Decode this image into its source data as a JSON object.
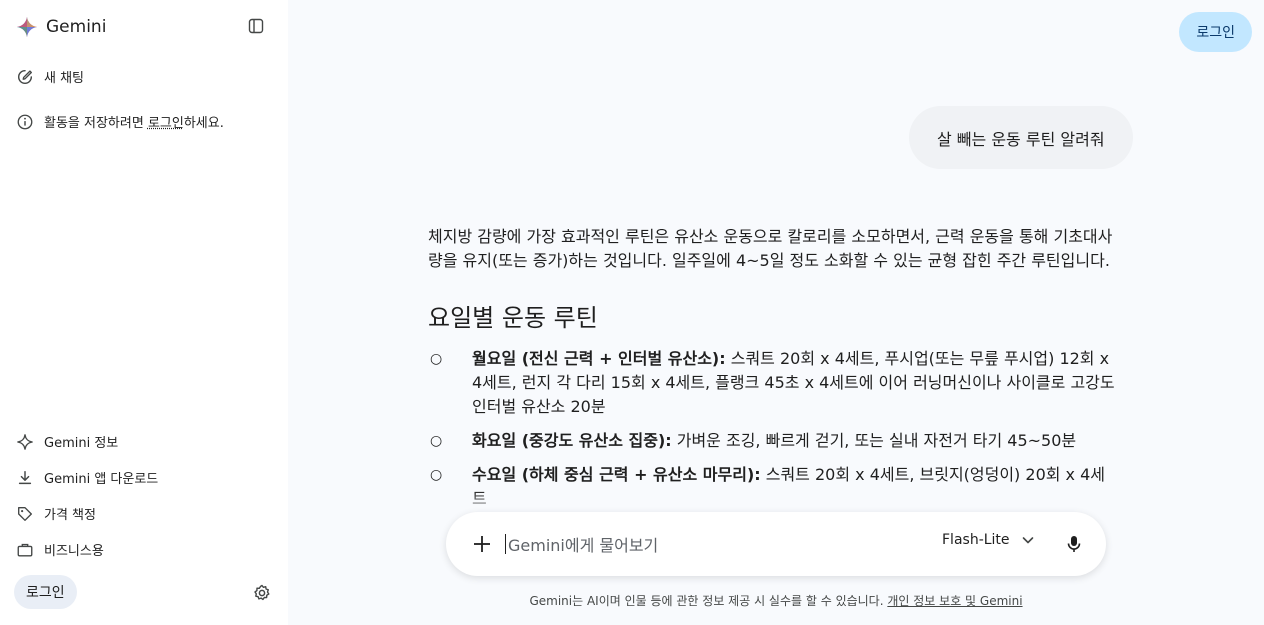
{
  "sidebar": {
    "brand": "Gemini",
    "new_chat": "새 채팅",
    "hint_prefix": "활동을 저장하려면 ",
    "hint_link": "로그인",
    "hint_suffix": "하세요.",
    "bottom_items": [
      {
        "label": "Gemini 정보",
        "icon": "sparkle-icon"
      },
      {
        "label": "Gemini 앱 다운로드",
        "icon": "download-icon"
      },
      {
        "label": "가격 책정",
        "icon": "tag-icon"
      },
      {
        "label": "비즈니스용",
        "icon": "briefcase-icon"
      }
    ],
    "login": "로그인"
  },
  "header": {
    "login": "로그인"
  },
  "chat": {
    "user_message": "살 빼는 운동 루틴 알려줘",
    "response_intro": "체지방 감량에 가장 효과적인 루틴은 유산소 운동으로 칼로리를 소모하면서, 근력 운동을 통해 기초대사량을 유지(또는 증가)하는 것입니다. 일주일에 4~5일 정도 소화할 수 있는 균형 잡힌 주간 루틴입니다.",
    "section_title": "요일별 운동 루틴",
    "items": [
      {
        "bold": "월요일 (전신 근력 + 인터벌 유산소):",
        "text": " 스쿼트 20회 x 4세트, 푸시업(또는 무릎 푸시업) 12회 x 4세트, 런지 각 다리 15회 x 4세트, 플랭크 45초 x 4세트에 이어 러닝머신이나 사이클로 고강도 인터벌 유산소 20분"
      },
      {
        "bold": "화요일 (중강도 유산소 집중):",
        "text": " 가벼운 조깅, 빠르게 걷기, 또는 실내 자전거 타기 45~50분"
      },
      {
        "bold": "수요일 (하체 중심 근력 + 유산소 마무리):",
        "text": " 스쿼트 20회 x 4세트, 브릿지(엉덩이) 20회 x 4세트"
      }
    ]
  },
  "composer": {
    "placeholder": "Gemini에게 물어보기",
    "model": "Flash-Lite"
  },
  "footer": {
    "disclaimer": "Gemini는 AI이며 인물 등에 관한 정보 제공 시 실수를 할 수 있습니다. ",
    "link": "개인 정보 보호 및 Gemini"
  },
  "colors": {
    "accent": "#c2e7ff",
    "background": "#f8fafd"
  }
}
